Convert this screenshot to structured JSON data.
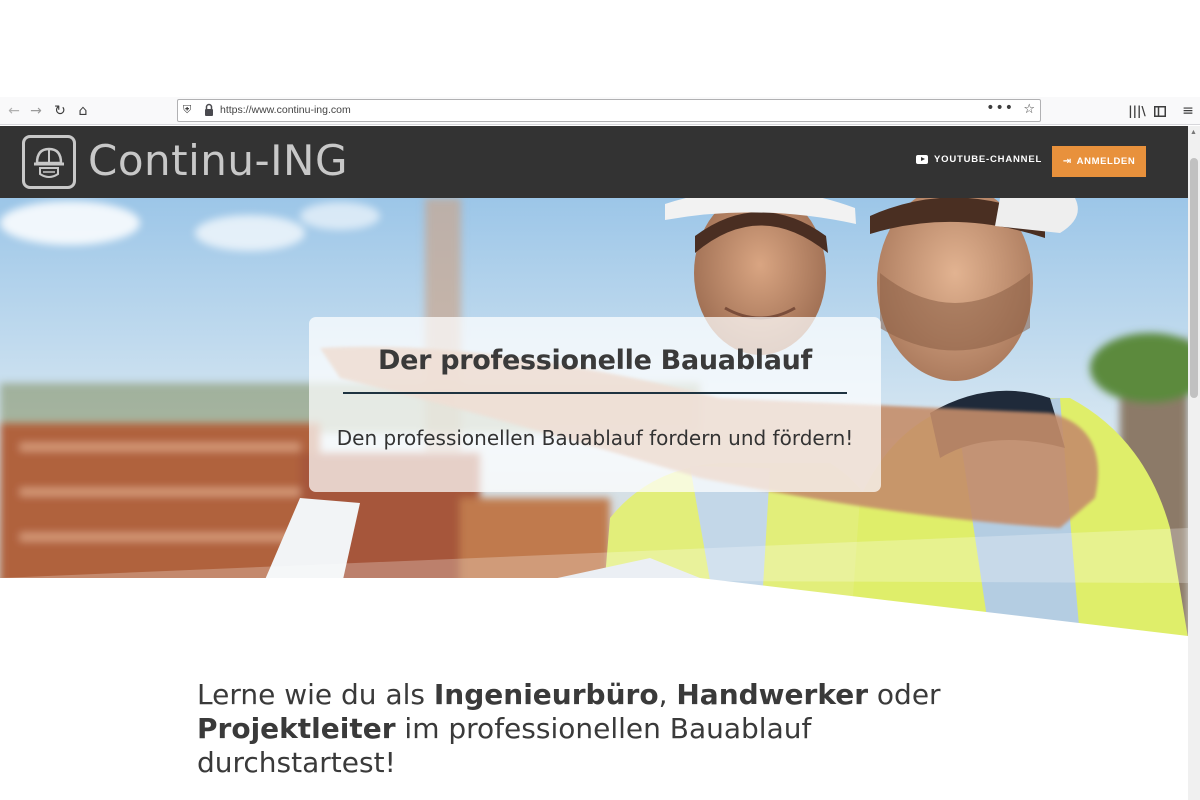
{
  "browser": {
    "url": "https://www.continu-ing.com",
    "icons": [
      "back-arrow-icon",
      "forward-arrow-icon",
      "reload-icon",
      "home-icon",
      "shield-icon",
      "lock-icon",
      "more-dots-icon",
      "bookmark-star-icon",
      "library-icon",
      "sidebar-icon",
      "menu-icon"
    ]
  },
  "header": {
    "logo_text": "Continu-ING",
    "youtube_label": "YOUTUBE-CHANNEL",
    "login_label": "ANMELDEN",
    "bg_color": "#333333",
    "accent_color": "#e8913c"
  },
  "hero": {
    "title": "Der professionelle Bauablauf",
    "subtitle": "Den professionellen Bauablauf fordern und fördern!"
  },
  "intro": {
    "p1": "Lerne wie du als ",
    "b1": "Ingenieurbüro",
    "p2": ", ",
    "b2": "Handwerker",
    "p3": " oder ",
    "b3": "Projektleiter",
    "p4": " im professionellen Bauablauf durchstartest!"
  }
}
